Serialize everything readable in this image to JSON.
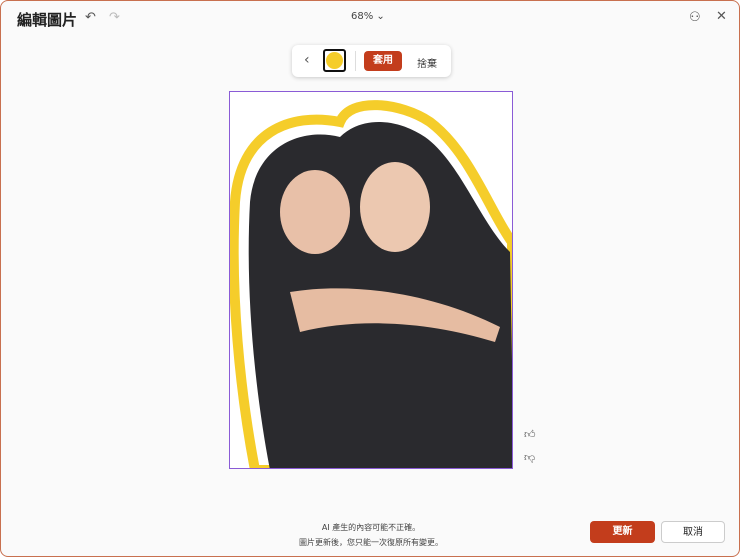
{
  "header": {
    "title": "編輯圖片",
    "zoom": "68%"
  },
  "toolbar": {
    "back": "‹",
    "apply": "套用",
    "discard": "捨棄",
    "color": "#f5cd2a"
  },
  "feedback": {
    "like": "👍",
    "dislike": "👎"
  },
  "footer": {
    "notice1": "AI 產生的內容可能不正確。",
    "notice2": "圖片更新後，您只能一次復原所有變更。",
    "update": "更新",
    "cancel": "取消"
  },
  "colors": {
    "accent": "#c33d1c",
    "selection": "#8a5bd6"
  }
}
